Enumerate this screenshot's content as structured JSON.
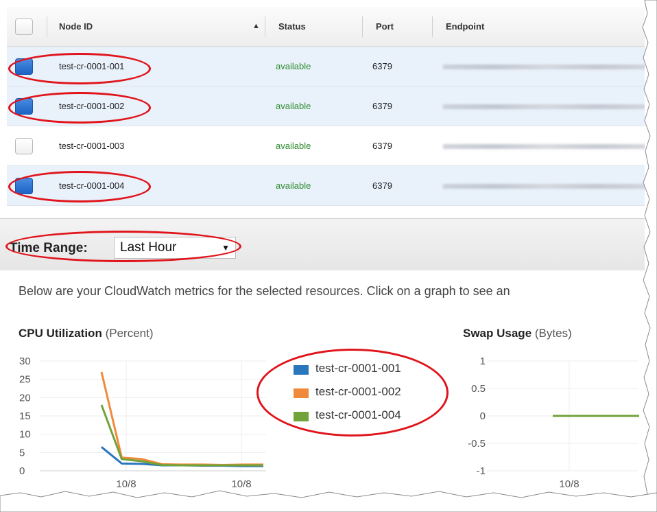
{
  "table": {
    "columns": {
      "node_id": "Node ID",
      "status": "Status",
      "port": "Port",
      "endpoint": "Endpoint"
    },
    "rows": [
      {
        "node_id": "test-cr-0001-001",
        "status": "available",
        "port": "6379",
        "selected": true
      },
      {
        "node_id": "test-cr-0001-002",
        "status": "available",
        "port": "6379",
        "selected": true
      },
      {
        "node_id": "test-cr-0001-003",
        "status": "available",
        "port": "6379",
        "selected": false
      },
      {
        "node_id": "test-cr-0001-004",
        "status": "available",
        "port": "6379",
        "selected": true
      }
    ]
  },
  "time_range": {
    "label": "Time Range:",
    "value": "Last Hour"
  },
  "info_text": "Below are your CloudWatch metrics for the selected resources. Click on a graph to see an",
  "colors": {
    "series_1": "#2a76bd",
    "series_2": "#f08a3a",
    "series_3": "#72a33a",
    "annotation": "#e0141a",
    "status_green": "#2e8b2e",
    "selected_row": "#e9f1fb"
  },
  "chart_data": [
    {
      "type": "line",
      "title": "CPU Utilization",
      "unit": "(Percent)",
      "x_ticks": [
        "10/8",
        "10/8"
      ],
      "y_ticks": [
        "30",
        "25",
        "20",
        "15",
        "10",
        "5",
        "0"
      ],
      "ylim": [
        0,
        30
      ],
      "x_points": [
        0,
        1,
        2,
        3,
        4,
        5,
        6,
        7,
        8
      ],
      "series": [
        {
          "name": "test-cr-0001-001",
          "values": [
            6.5,
            2.0,
            1.9,
            1.5,
            1.5,
            1.4,
            1.4,
            1.3,
            1.3
          ]
        },
        {
          "name": "test-cr-0001-002",
          "values": [
            27,
            3.6,
            3.2,
            1.8,
            1.7,
            1.7,
            1.6,
            1.7,
            1.7
          ]
        },
        {
          "name": "test-cr-0001-004",
          "values": [
            18,
            3.2,
            2.6,
            1.6,
            1.5,
            1.5,
            1.5,
            1.5,
            1.5
          ]
        }
      ]
    },
    {
      "type": "line",
      "title": "Swap Usage",
      "unit": "(Bytes)",
      "x_ticks": [
        "10/8"
      ],
      "y_ticks": [
        "1",
        "0.5",
        "0",
        "-0.5",
        "-1"
      ],
      "ylim": [
        -1,
        1
      ],
      "series": [
        {
          "name": "test-cr-0001-001",
          "values": [
            0,
            0
          ]
        },
        {
          "name": "test-cr-0001-002",
          "values": [
            0,
            0
          ]
        },
        {
          "name": "test-cr-0001-004",
          "values": [
            0,
            0
          ]
        }
      ]
    }
  ],
  "icons": {
    "checkbox": "checkbox-icon",
    "sort": "sort-ascending-icon",
    "dropdown": "dropdown-arrow-icon"
  }
}
